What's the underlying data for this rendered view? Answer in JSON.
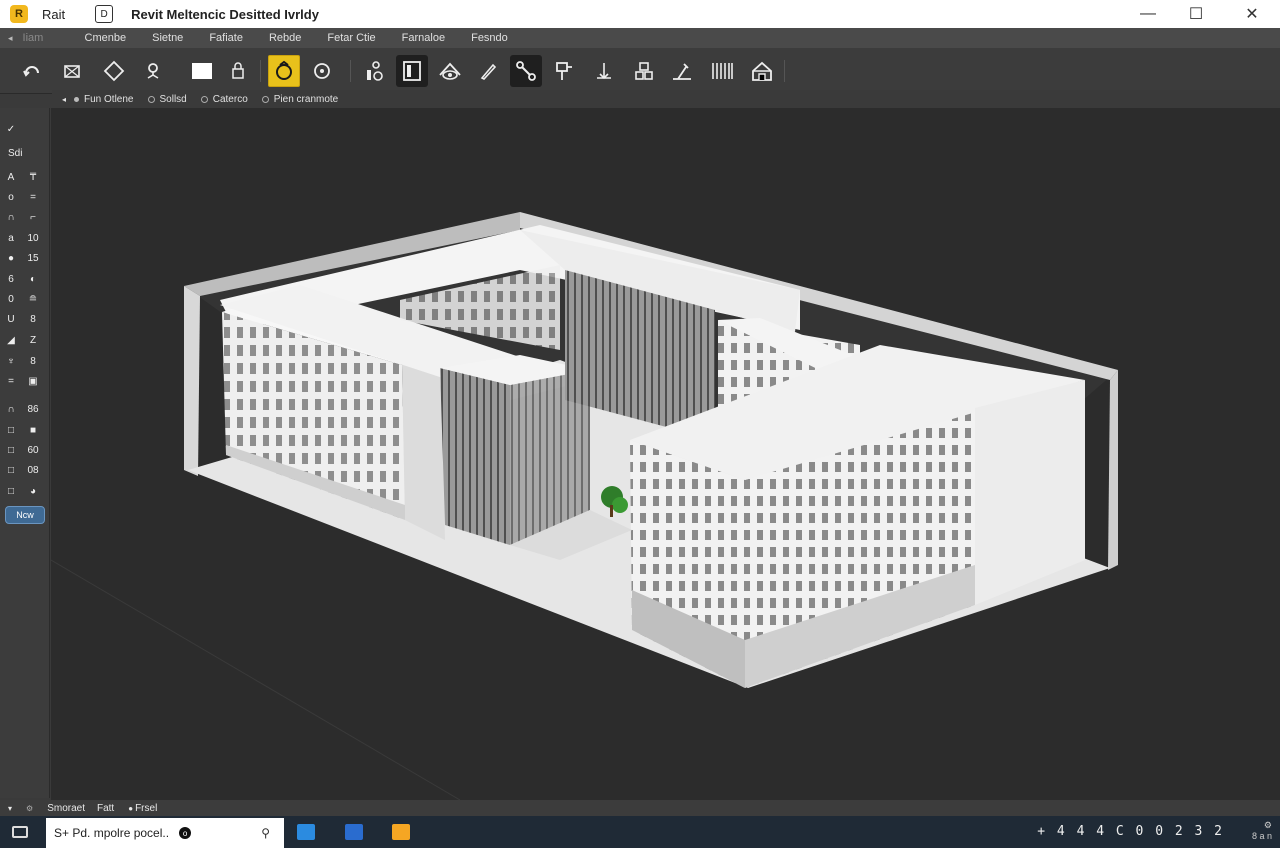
{
  "titlebar": {
    "app_name": "Rait",
    "title": "Revit Meltencic Desitted Ivrldy",
    "minimize": "—",
    "maximize": "☐",
    "close": "✕"
  },
  "menubar": {
    "back": "◂",
    "home": "Iiam",
    "tabs": [
      "Cmenbe",
      "Sietne",
      "Fafiate",
      "Rebde",
      "Fetar Ctie",
      "Farnaloe",
      "Fesndo"
    ]
  },
  "ribbon": {
    "tools": [
      {
        "icon": "rotate-icon"
      },
      {
        "icon": "section-box-icon"
      },
      {
        "icon": "diamond-icon"
      },
      {
        "icon": "pin-icon"
      },
      {
        "icon": "rectangle-icon"
      },
      {
        "icon": "lock-icon"
      },
      {
        "icon": "orbit-icon"
      },
      {
        "icon": "target-icon"
      },
      {
        "icon": "component-icon"
      },
      {
        "icon": "door-icon"
      },
      {
        "icon": "eye-icon"
      },
      {
        "icon": "pen-icon"
      },
      {
        "icon": "connector-icon"
      },
      {
        "icon": "tag-icon"
      },
      {
        "icon": "stair-icon"
      },
      {
        "icon": "group-icon"
      },
      {
        "icon": "trim-icon"
      },
      {
        "icon": "curtain-wall-icon"
      },
      {
        "icon": "home-icon"
      }
    ]
  },
  "options": {
    "items": [
      "Fun Otlene",
      "Sollsd",
      "Caterco",
      "Pien cranmote"
    ]
  },
  "leftpanel": {
    "header": "Sdi",
    "rows": [
      [
        "A",
        "₸"
      ],
      [
        "o",
        "="
      ],
      [
        "∩",
        "⌐"
      ],
      [
        "a",
        "10"
      ],
      [
        "●",
        "15"
      ],
      [
        "6",
        "◐"
      ],
      [
        "0",
        "≘"
      ],
      [
        "U",
        "8"
      ],
      [
        "◢",
        "Z"
      ],
      [
        "♆",
        "8"
      ],
      [
        "=",
        "▣"
      ],
      [
        "∩",
        "86"
      ],
      [
        "□",
        "■"
      ],
      [
        "□",
        "60"
      ],
      [
        "□",
        "08"
      ],
      [
        "□",
        "◕"
      ]
    ],
    "button": "Ncw"
  },
  "statusbar": {
    "items": [
      "Smoraet",
      "Fatt",
      "Frsel"
    ]
  },
  "taskbar": {
    "search": "S+ Pd. mpolre pocel..",
    "tray": "+ 4 4 4 C 0 0 2 3 2",
    "tray_small": "8 a n"
  },
  "colors": {
    "accent": "#e8c11b",
    "button_blue": "#3f6a94",
    "viewport_bg": "#2c2c2c"
  }
}
